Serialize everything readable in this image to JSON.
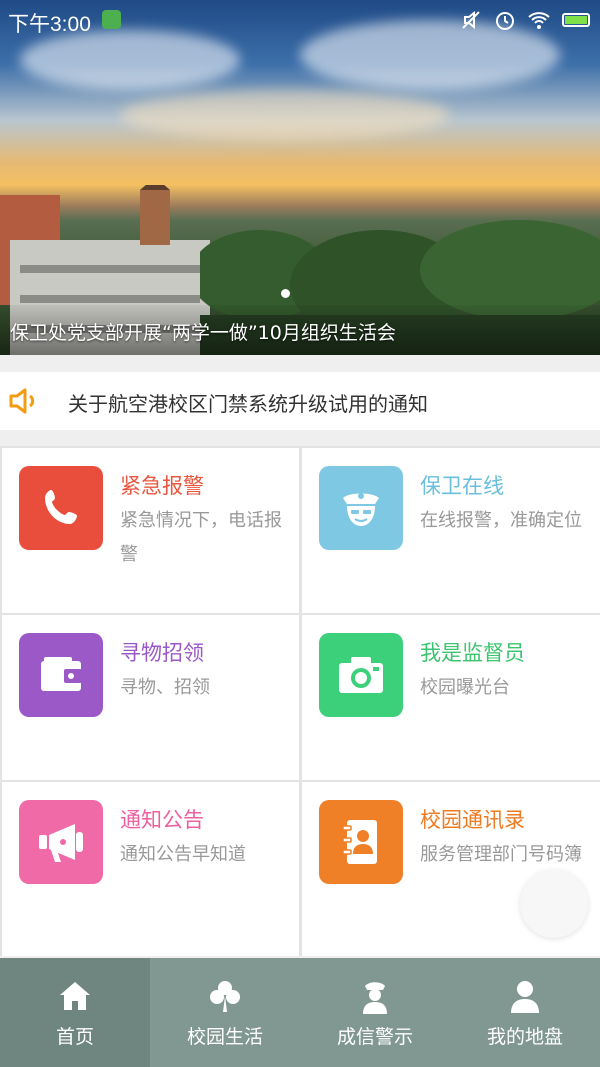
{
  "status_bar": {
    "time": "下午3:00"
  },
  "banner": {
    "caption": "保卫处党支部开展“两学一做”10月组织生活会"
  },
  "notice": {
    "icon": "speaker-icon",
    "text": "关于航空港校区门禁系统升级试用的通知"
  },
  "tiles": [
    {
      "title": "紧急报警",
      "desc": "紧急情况下，电话报警",
      "icon": "phone-icon",
      "color": "#e94e3c",
      "title_color": "#e9573f"
    },
    {
      "title": "保卫在线",
      "desc": "在线报警，准确定位",
      "icon": "police-icon",
      "color": "#7ec8e3",
      "title_color": "#6bbfdc"
    },
    {
      "title": "寻物招领",
      "desc": "寻物、招领",
      "icon": "wallet-icon",
      "color": "#9b59c7",
      "title_color": "#9b59c7"
    },
    {
      "title": "我是监督员",
      "desc": "校园曝光台",
      "icon": "camera-icon",
      "color": "#3dd07a",
      "title_color": "#3cc46f"
    },
    {
      "title": "通知公告",
      "desc": "通知公告早知道",
      "icon": "megaphone-icon",
      "color": "#f06aa7",
      "title_color": "#ee5fa0"
    },
    {
      "title": "校园通讯录",
      "desc": "服务管理部门号码簿",
      "icon": "contacts-icon",
      "color": "#f08027",
      "title_color": "#ee7a22"
    }
  ],
  "bottom_nav": [
    {
      "label": "首页",
      "icon": "home-icon",
      "active": true
    },
    {
      "label": "校园生活",
      "icon": "clover-icon",
      "active": false
    },
    {
      "label": "成信警示",
      "icon": "police-officer-icon",
      "active": false
    },
    {
      "label": "我的地盘",
      "icon": "user-icon",
      "active": false
    }
  ]
}
